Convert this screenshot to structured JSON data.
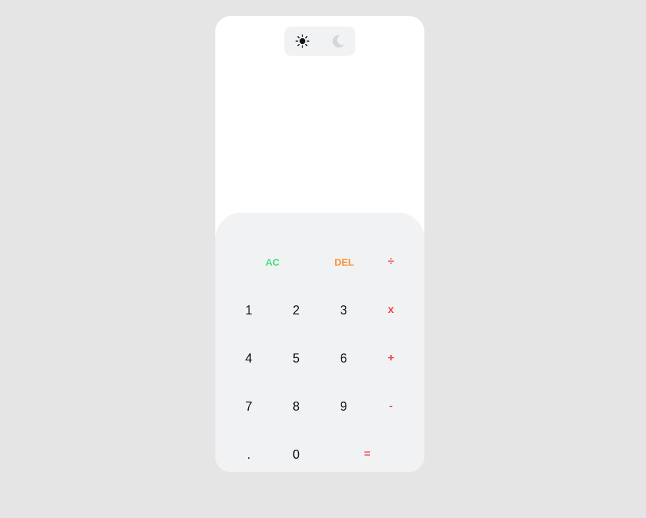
{
  "theme": {
    "sun_icon": "sun-icon",
    "moon_icon": "moon-icon",
    "active": "light"
  },
  "display": {
    "expression": "",
    "result": ""
  },
  "keypad": {
    "ac": "AC",
    "del": "DEL",
    "divide": "÷",
    "one": "1",
    "two": "2",
    "three": "3",
    "multiply": "x",
    "four": "4",
    "five": "5",
    "six": "6",
    "plus": "+",
    "seven": "7",
    "eight": "8",
    "nine": "9",
    "minus": "-",
    "dot": ".",
    "zero": "0",
    "equals": "="
  },
  "colors": {
    "background": "#e5e5e5",
    "card": "#ffffff",
    "keypad_bg": "#f1f2f4",
    "ac": "#4ade80",
    "del": "#fb923c",
    "operator": "#ef4444",
    "digit": "#111111",
    "moon_inactive": "#d4d6dd"
  }
}
